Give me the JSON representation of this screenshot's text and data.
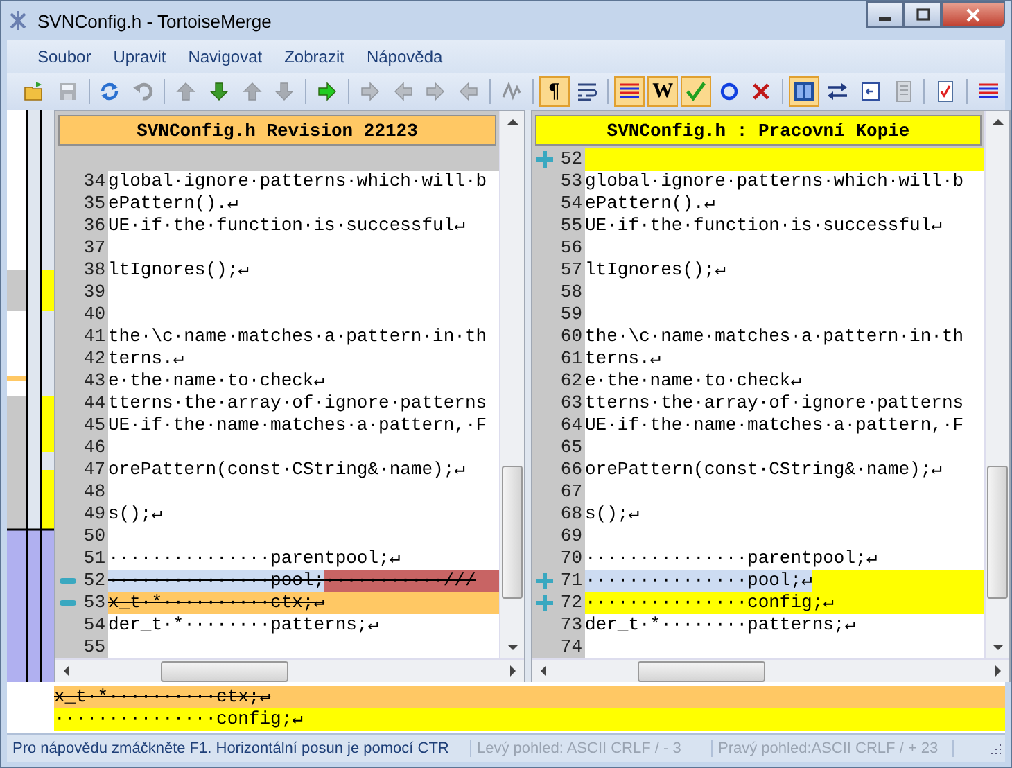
{
  "window": {
    "title": "SVNConfig.h - TortoiseMerge"
  },
  "menu": [
    "Soubor",
    "Upravit",
    "Navigovat",
    "Zobrazit",
    "Nápověda"
  ],
  "toolbar": {
    "groups": [
      {
        "buttons": [
          {
            "kind": "open",
            "pressed": false,
            "disabled": false
          },
          {
            "kind": "save",
            "pressed": false,
            "disabled": true
          }
        ]
      },
      {
        "buttons": [
          {
            "kind": "reload",
            "pressed": false,
            "disabled": false
          },
          {
            "kind": "undo",
            "pressed": false,
            "disabled": true
          }
        ]
      },
      {
        "buttons": [
          {
            "kind": "up",
            "pressed": false,
            "disabled": true
          },
          {
            "kind": "down",
            "pressed": false,
            "disabled": false
          },
          {
            "kind": "up",
            "pressed": false,
            "disabled": true
          },
          {
            "kind": "down",
            "pressed": false,
            "disabled": true
          }
        ]
      },
      {
        "buttons": [
          {
            "kind": "right",
            "pressed": false,
            "disabled": false
          }
        ]
      },
      {
        "buttons": [
          {
            "kind": "right",
            "pressed": false,
            "disabled": true
          },
          {
            "kind": "left",
            "pressed": false,
            "disabled": true
          },
          {
            "kind": "right",
            "pressed": false,
            "disabled": true
          },
          {
            "kind": "left",
            "pressed": false,
            "disabled": true
          }
        ]
      },
      {
        "buttons": [
          {
            "kind": "zigzag",
            "pressed": false,
            "disabled": true
          }
        ]
      },
      {
        "buttons": [
          {
            "kind": "glyph",
            "label": "¶",
            "pressed": true,
            "disabled": false
          },
          {
            "kind": "wrap",
            "pressed": false,
            "disabled": false
          }
        ]
      },
      {
        "buttons": [
          {
            "kind": "lines",
            "pressed": true,
            "disabled": false
          },
          {
            "kind": "glyph",
            "label": "W",
            "pressed": true,
            "disabled": false
          },
          {
            "kind": "check",
            "pressed": true,
            "disabled": false
          },
          {
            "kind": "circle",
            "pressed": false,
            "disabled": false
          },
          {
            "kind": "cross",
            "pressed": false,
            "disabled": false
          }
        ]
      },
      {
        "buttons": [
          {
            "kind": "panes",
            "pressed": true,
            "disabled": false
          },
          {
            "kind": "swap",
            "pressed": false,
            "disabled": false
          },
          {
            "kind": "panel",
            "pressed": false,
            "disabled": false
          },
          {
            "kind": "document",
            "pressed": false,
            "disabled": true
          }
        ]
      },
      {
        "buttons": [
          {
            "kind": "checklist",
            "pressed": false,
            "disabled": false
          }
        ]
      },
      {
        "buttons": [
          {
            "kind": "lines",
            "pressed": false,
            "disabled": false
          }
        ]
      }
    ]
  },
  "panes": [
    {
      "kind": "base",
      "title": "SVNConfig.h Revision 22123",
      "lines": [
        {
          "kind": "empty"
        },
        {
          "kind": "normal",
          "number": "34",
          "text": "global·ignore·patterns·which·will·b"
        },
        {
          "kind": "normal",
          "number": "35",
          "text": "ePattern().↵"
        },
        {
          "kind": "normal",
          "number": "36",
          "text": "UE·if·the·function·is·successful↵"
        },
        {
          "kind": "normal",
          "number": "37"
        },
        {
          "kind": "normal",
          "number": "38",
          "text": "ltIgnores();↵"
        },
        {
          "kind": "normal",
          "number": "39"
        },
        {
          "kind": "normal",
          "number": "40"
        },
        {
          "kind": "normal",
          "number": "41",
          "text": "the·\\c·name·matches·a·pattern·in·th"
        },
        {
          "kind": "normal",
          "number": "42",
          "text": "terns.↵"
        },
        {
          "kind": "normal",
          "number": "43",
          "text": "e·the·name·to·check↵"
        },
        {
          "kind": "normal",
          "number": "44",
          "text": "tterns·the·array·of·ignore·patterns"
        },
        {
          "kind": "normal",
          "number": "45",
          "text": "UE·if·the·name·matches·a·pattern,·F"
        },
        {
          "kind": "normal",
          "number": "46"
        },
        {
          "kind": "normal",
          "number": "47",
          "text": "orePattern(const·CString&·name);↵"
        },
        {
          "kind": "normal",
          "number": "48"
        },
        {
          "kind": "normal",
          "number": "49",
          "text": "s();↵"
        },
        {
          "kind": "normal",
          "number": "50"
        },
        {
          "kind": "normal",
          "number": "51",
          "text": "···············parentpool;↵"
        },
        {
          "kind": "removed",
          "number": "52",
          "text": "···············pool;",
          "inline_removed": "···········///",
          "selected": true
        },
        {
          "kind": "removed",
          "number": "53",
          "text": "x_t·*··········ctx;↵"
        },
        {
          "kind": "normal",
          "number": "54",
          "text": "der_t·*········patterns;↵"
        },
        {
          "kind": "normal",
          "number": "55"
        }
      ]
    },
    {
      "kind": "working",
      "title": "SVNConfig.h : Pracovní Kopie",
      "lines": [
        {
          "kind": "added",
          "number": "52"
        },
        {
          "kind": "normal",
          "number": "53",
          "text": "global·ignore·patterns·which·will·b"
        },
        {
          "kind": "normal",
          "number": "54",
          "text": "ePattern().↵"
        },
        {
          "kind": "normal",
          "number": "55",
          "text": "UE·if·the·function·is·successful↵"
        },
        {
          "kind": "normal",
          "number": "56"
        },
        {
          "kind": "normal",
          "number": "57",
          "text": "ltIgnores();↵"
        },
        {
          "kind": "normal",
          "number": "58"
        },
        {
          "kind": "normal",
          "number": "59"
        },
        {
          "kind": "normal",
          "number": "60",
          "text": "the·\\c·name·matches·a·pattern·in·th"
        },
        {
          "kind": "normal",
          "number": "61",
          "text": "terns.↵"
        },
        {
          "kind": "normal",
          "number": "62",
          "text": "e·the·name·to·check↵"
        },
        {
          "kind": "normal",
          "number": "63",
          "text": "tterns·the·array·of·ignore·patterns"
        },
        {
          "kind": "normal",
          "number": "64",
          "text": "UE·if·the·name·matches·a·pattern,·F"
        },
        {
          "kind": "normal",
          "number": "65"
        },
        {
          "kind": "normal",
          "number": "66",
          "text": "orePattern(const·CString&·name);↵"
        },
        {
          "kind": "normal",
          "number": "67"
        },
        {
          "kind": "normal",
          "number": "68",
          "text": "s();↵"
        },
        {
          "kind": "normal",
          "number": "69"
        },
        {
          "kind": "normal",
          "number": "70",
          "text": "···············parentpool;↵"
        },
        {
          "kind": "added",
          "number": "71",
          "text": "···············pool;↵",
          "selected": true
        },
        {
          "kind": "added",
          "number": "72",
          "text": "···············config;↵"
        },
        {
          "kind": "normal",
          "number": "73",
          "text": "der_t·*········patterns;↵"
        },
        {
          "kind": "normal",
          "number": "74"
        }
      ]
    }
  ],
  "bottom_view": {
    "lines": [
      {
        "kind": "removed",
        "text": "x_t·*··········ctx;↵"
      },
      {
        "kind": "added",
        "text": "···············config;↵"
      }
    ]
  },
  "status_bar": [
    {
      "text": "Pro nápovědu zmáčkněte F1. Horizontální posun je pomocí CTR",
      "disabled": false
    },
    {
      "text": "Levý pohled: ASCII CRLF  / - 3",
      "disabled": true
    },
    {
      "text": "Pravý pohled:ASCII CRLF  / + 23",
      "disabled": true
    }
  ]
}
